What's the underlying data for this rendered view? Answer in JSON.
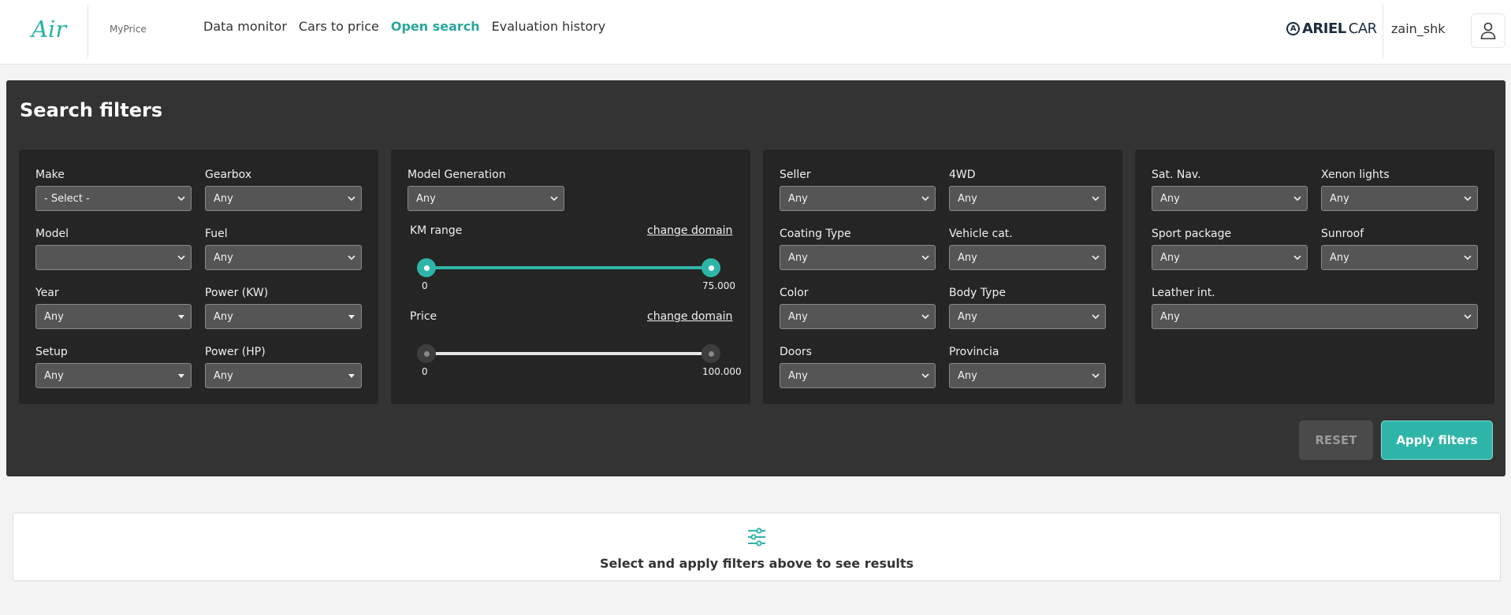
{
  "header": {
    "logo": "Air",
    "app_name": "MyPrice",
    "nav": [
      "Data monitor",
      "Cars to price",
      "Open search",
      "Evaluation history"
    ],
    "active_nav": "Open search",
    "brand_bold": "ARIEL",
    "brand_thin": "CAR",
    "username": "zain_shk"
  },
  "filters": {
    "title": "Search filters",
    "card1": {
      "make": {
        "label": "Make",
        "value": "- Select -"
      },
      "gearbox": {
        "label": "Gearbox",
        "value": "Any"
      },
      "model": {
        "label": "Model",
        "value": ""
      },
      "fuel": {
        "label": "Fuel",
        "value": "Any"
      },
      "year": {
        "label": "Year",
        "value": "Any"
      },
      "power_kw": {
        "label": "Power (KW)",
        "value": "Any"
      },
      "setup": {
        "label": "Setup",
        "value": "Any"
      },
      "power_hp": {
        "label": "Power (HP)",
        "value": "Any"
      }
    },
    "card2": {
      "model_generation": {
        "label": "Model Generation",
        "value": "Any"
      },
      "km_range": {
        "label": "KM range",
        "change_domain": "change domain",
        "min_label": "0",
        "max_label": "75.000",
        "low": 0,
        "high": 75000
      },
      "price": {
        "label": "Price",
        "change_domain": "change domain",
        "min_label": "0",
        "max_label": "100.000",
        "low": 0,
        "high": 100000
      }
    },
    "card3": {
      "seller": {
        "label": "Seller",
        "value": "Any"
      },
      "fourwd": {
        "label": "4WD",
        "value": "Any"
      },
      "coating_type": {
        "label": "Coating Type",
        "value": "Any"
      },
      "vehicle_cat": {
        "label": "Vehicle cat.",
        "value": "Any"
      },
      "color": {
        "label": "Color",
        "value": "Any"
      },
      "body_type": {
        "label": "Body Type",
        "value": "Any"
      },
      "doors": {
        "label": "Doors",
        "value": "Any"
      },
      "provincia": {
        "label": "Provincia",
        "value": "Any"
      }
    },
    "card4": {
      "sat_nav": {
        "label": "Sat. Nav.",
        "value": "Any"
      },
      "xenon": {
        "label": "Xenon lights",
        "value": "Any"
      },
      "sport_package": {
        "label": "Sport package",
        "value": "Any"
      },
      "sunroof": {
        "label": "Sunroof",
        "value": "Any"
      },
      "leather": {
        "label": "Leather int.",
        "value": "Any"
      }
    },
    "reset_label": "RESET",
    "apply_label": "Apply filters"
  },
  "results": {
    "message": "Select and apply filters above to see results"
  },
  "colors": {
    "accent": "#2fb5a8",
    "panel_bg": "#333333",
    "card_bg": "#252525"
  }
}
